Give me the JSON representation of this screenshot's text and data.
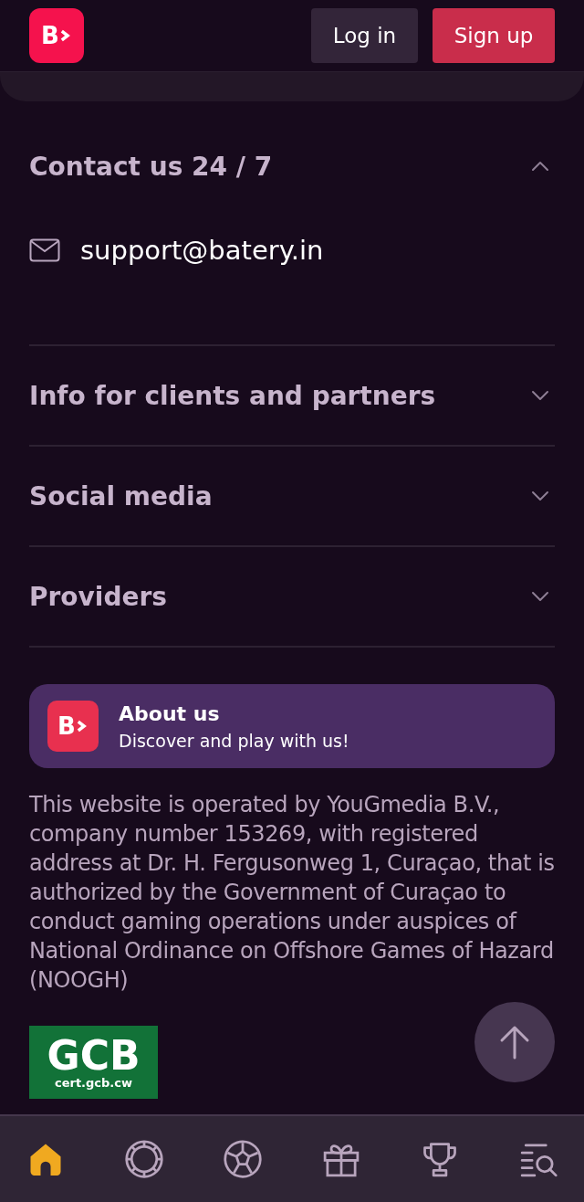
{
  "header": {
    "logo": "B",
    "buttons": [
      {
        "label": "Log in",
        "kind": "secondary"
      },
      {
        "label": "Sign up",
        "kind": "primary"
      }
    ]
  },
  "sections": [
    {
      "title": "Contact us 24 / 7",
      "expanded": true,
      "email": "support@batery.in"
    },
    {
      "title": "Info for clients and partners",
      "expanded": false
    },
    {
      "title": "Social media",
      "expanded": false
    },
    {
      "title": "Providers",
      "expanded": false
    }
  ],
  "about": {
    "logo": "B",
    "title": "About us",
    "subtitle": "Discover and play with us!"
  },
  "legal_text": "This website is operated by YouGmedia B.V., company number 153269, with registered address at Dr. H. Fergusonweg 1, Curaçao, that is authorized by the Government of Curaçao to conduct gaming operations under auspices of National Ordinance on Offshore Games of Hazard (NOOGH)",
  "license_badge": {
    "title": "GCB",
    "url": "cert.gcb.cw"
  },
  "bottom_nav": [
    {
      "kind": "home",
      "selected": true
    },
    {
      "kind": "casino",
      "selected": false
    },
    {
      "kind": "sports",
      "selected": false
    },
    {
      "kind": "gifts",
      "selected": false
    },
    {
      "kind": "tournaments",
      "selected": false
    },
    {
      "kind": "search",
      "selected": false
    }
  ]
}
